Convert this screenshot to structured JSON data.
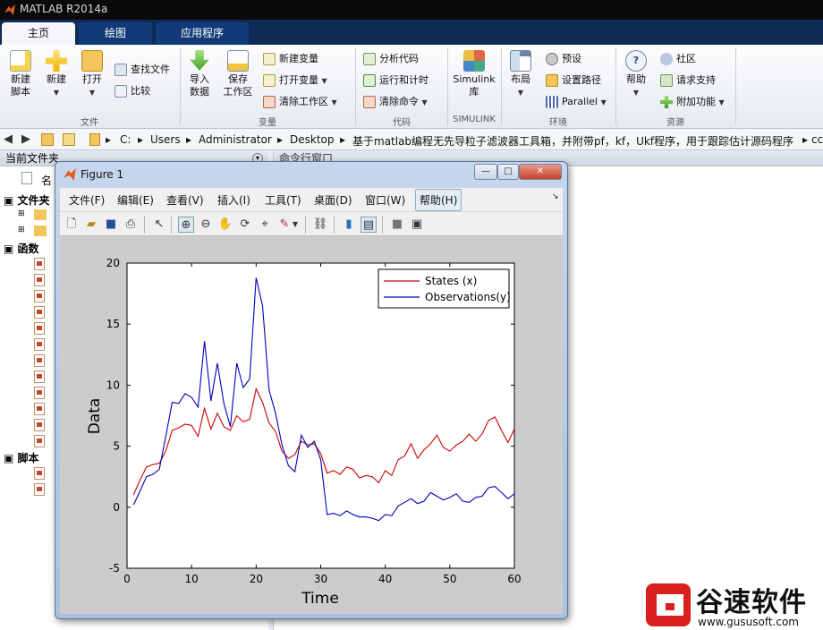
{
  "app_title": "MATLAB R2014a",
  "tabs": [
    "主页",
    "绘图",
    "应用程序"
  ],
  "ribbon": {
    "file": {
      "new_script": "新建\n脚本",
      "new": "新建",
      "open": "打开",
      "find_files": "查找文件",
      "compare": "比较",
      "label": "文件"
    },
    "variable": {
      "import": "导入\n数据",
      "save_ws": "保存\n工作区",
      "new_var": "新建变量",
      "open_var": "打开变量",
      "clear_ws": "清除工作区",
      "label": "变量"
    },
    "code": {
      "analyze": "分析代码",
      "run_time": "运行和计时",
      "clear_cmd": "清除命令",
      "label": "代码"
    },
    "simulink": {
      "lib": "Simulink\n库",
      "label": "SIMULINK"
    },
    "env": {
      "layout": "布局",
      "prefs": "预设",
      "set_path": "设置路径",
      "parallel": "Parallel",
      "label": "环境"
    },
    "resources": {
      "help": "帮助",
      "community": "社区",
      "support": "请求支持",
      "addons": "附加功能",
      "label": "资源"
    }
  },
  "address": [
    "C:",
    "Users",
    "Administrator",
    "Desktop",
    "基于matlab编程无先导粒子滤波器工具箱，并附带pf，kf，Ukf程序，用于跟踪估计源码程序",
    "cc"
  ],
  "left_pane": {
    "title": "当前文件夹",
    "name_col": "名",
    "folders_label": "文件夹",
    "functions_label": "函数",
    "scripts_label": "脚本"
  },
  "right_pane": {
    "title": "命令行窗口"
  },
  "figure": {
    "title": "Figure 1",
    "menu": [
      "文件(F)",
      "编辑(E)",
      "查看(V)",
      "插入(I)",
      "工具(T)",
      "桌面(D)",
      "窗口(W)",
      "帮助(H)"
    ],
    "win_min": "—",
    "win_max": "□",
    "win_close": "✕"
  },
  "chart_data": {
    "type": "line",
    "title": "",
    "xlabel": "Time",
    "ylabel": "Data",
    "xlim": [
      0,
      60
    ],
    "ylim": [
      -5,
      20
    ],
    "xticks": [
      0,
      10,
      20,
      30,
      40,
      50,
      60
    ],
    "yticks": [
      -5,
      0,
      5,
      10,
      15,
      20
    ],
    "legend_position": "top-right",
    "series": [
      {
        "name": "States (x)",
        "color": "#cc0000",
        "x": [
          1,
          2,
          3,
          4,
          5,
          6,
          7,
          8,
          9,
          10,
          11,
          12,
          13,
          14,
          15,
          16,
          17,
          18,
          19,
          20,
          21,
          22,
          23,
          24,
          25,
          26,
          27,
          28,
          29,
          30,
          31,
          32,
          33,
          34,
          35,
          36,
          37,
          38,
          39,
          40,
          41,
          42,
          43,
          44,
          45,
          46,
          47,
          48,
          49,
          50,
          51,
          52,
          53,
          54,
          55,
          56,
          57,
          58,
          59,
          60
        ],
        "y": [
          1.0,
          2.2,
          3.3,
          3.5,
          3.6,
          4.6,
          6.3,
          6.5,
          6.8,
          6.7,
          5.8,
          8.1,
          6.4,
          7.7,
          6.6,
          6.3,
          7.5,
          7.0,
          7.2,
          9.7,
          8.6,
          6.9,
          6.2,
          4.6,
          4.0,
          4.3,
          5.4,
          5.1,
          5.2,
          4.4,
          2.8,
          3.0,
          2.7,
          3.3,
          3.1,
          2.4,
          2.6,
          2.5,
          2.0,
          3.0,
          2.6,
          3.9,
          4.2,
          5.2,
          4.0,
          4.7,
          5.2,
          5.9,
          4.9,
          4.6,
          5.1,
          5.4,
          6.0,
          5.4,
          6.0,
          7.1,
          7.4,
          6.3,
          5.3,
          6.4
        ]
      },
      {
        "name": "Observations(y)",
        "color": "#0000bb",
        "x": [
          1,
          2,
          3,
          4,
          5,
          6,
          7,
          8,
          9,
          10,
          11,
          12,
          13,
          14,
          15,
          16,
          17,
          18,
          19,
          20,
          21,
          22,
          23,
          24,
          25,
          26,
          27,
          28,
          29,
          30,
          31,
          32,
          33,
          34,
          35,
          36,
          37,
          38,
          39,
          40,
          41,
          42,
          43,
          44,
          45,
          46,
          47,
          48,
          49,
          50,
          51,
          52,
          53,
          54,
          55,
          56,
          57,
          58,
          59,
          60
        ],
        "y": [
          0.2,
          1.3,
          2.5,
          2.7,
          3.1,
          5.8,
          8.6,
          8.5,
          9.3,
          9.0,
          8.2,
          13.6,
          8.7,
          11.8,
          8.5,
          6.6,
          11.8,
          9.8,
          10.5,
          18.8,
          16.5,
          9.6,
          7.7,
          5.1,
          3.4,
          2.9,
          5.9,
          4.9,
          5.4,
          3.9,
          -0.6,
          -0.5,
          -0.7,
          -0.3,
          -0.6,
          -0.8,
          -0.8,
          -0.9,
          -1.1,
          -0.6,
          -0.7,
          0.1,
          0.4,
          0.7,
          0.3,
          0.5,
          1.2,
          0.9,
          0.6,
          0.8,
          1.1,
          0.5,
          0.4,
          0.8,
          0.9,
          1.6,
          1.7,
          1.2,
          0.7,
          1.1
        ]
      }
    ]
  },
  "watermark": {
    "text": "谷速软件",
    "url": "www.gususoft.com"
  }
}
